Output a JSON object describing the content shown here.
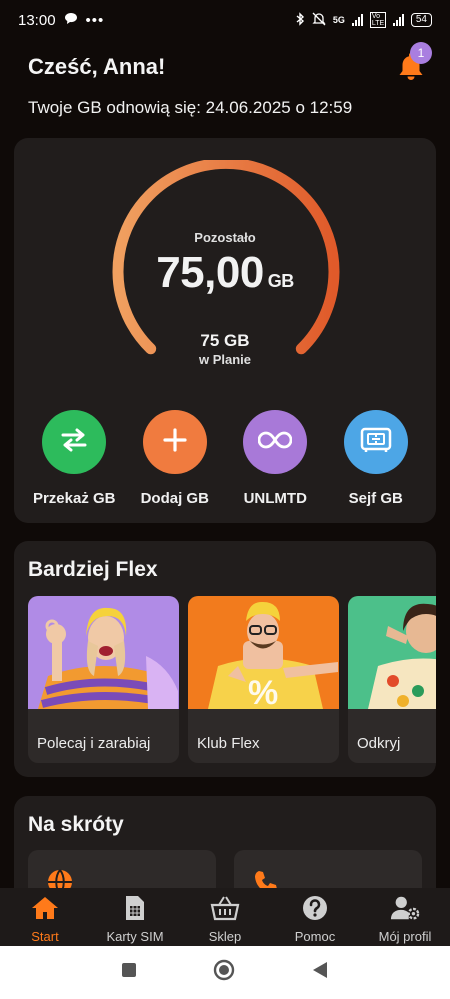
{
  "status_bar": {
    "time": "13:00",
    "network": "5G",
    "volte": "Vo LTE",
    "battery": "54"
  },
  "header": {
    "greeting": "Cześć, Anna!",
    "notification_count": "1",
    "renew_text": "Twoje GB odnowią się: 24.06.2025 o 12:59"
  },
  "data_card": {
    "remaining_label": "Pozostało",
    "remaining_value": "75,00",
    "remaining_unit": "GB",
    "plan_value": "75 GB",
    "plan_label": "w Planie",
    "remaining_fraction": 1.0,
    "gauge_colors": [
      "#f0a060",
      "#e05a2a"
    ],
    "actions": [
      {
        "label": "Przekaż GB",
        "icon": "transfer-icon",
        "color": "#2dbb5c"
      },
      {
        "label": "Dodaj GB",
        "icon": "plus-icon",
        "color": "#f07b3f"
      },
      {
        "label": "UNLMTD",
        "icon": "infinity-icon",
        "color": "#a879d8"
      },
      {
        "label": "Sejf GB",
        "icon": "safe-icon",
        "color": "#4da6e6"
      }
    ]
  },
  "flex_section": {
    "title": "Bardziej Flex",
    "promos": [
      {
        "title": "Polecaj i zarabiaj",
        "bg": "#b08be6"
      },
      {
        "title": "Klub Flex",
        "bg": "#f27b1d"
      },
      {
        "title": "Odkryj",
        "bg": "#4cc08a"
      }
    ]
  },
  "shortcuts": {
    "title": "Na skróty",
    "tiles": [
      {
        "icon": "globe-icon"
      },
      {
        "icon": "phone-icon"
      }
    ]
  },
  "bottom_nav": {
    "accent": "#ff7a1a",
    "items": [
      {
        "label": "Start",
        "icon": "home-icon"
      },
      {
        "label": "Karty SIM",
        "icon": "sim-icon"
      },
      {
        "label": "Sklep",
        "icon": "basket-icon"
      },
      {
        "label": "Pomoc",
        "icon": "help-icon"
      },
      {
        "label": "Mój profil",
        "icon": "profile-icon"
      }
    ]
  }
}
